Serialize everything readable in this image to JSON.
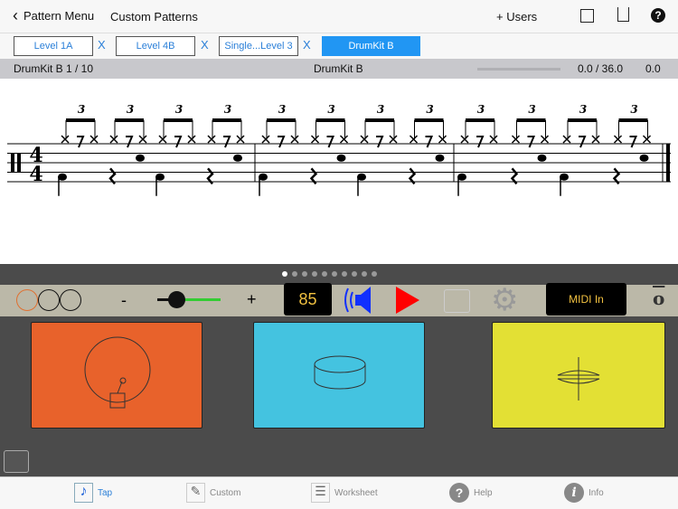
{
  "header": {
    "back_label": "Pattern Menu",
    "title": "Custom Patterns",
    "users_label": "+ Users"
  },
  "tabs": [
    {
      "label": "Level 1A",
      "close": "X"
    },
    {
      "label": "Level 4B",
      "close": "X"
    },
    {
      "label": "Single...Level 3",
      "close": "X"
    },
    {
      "label": "DrumKit B"
    }
  ],
  "info": {
    "left": "DrumKit B 1 / 10",
    "center": "DrumKit B",
    "time": "0.0 / 36.0",
    "value": "0.0",
    "progress": 0
  },
  "score": {
    "time_signature": [
      "4",
      "4"
    ],
    "tuplet": "3",
    "measures": 3
  },
  "pager": {
    "count": 10,
    "active": 0
  },
  "toolbar": {
    "minus": "-",
    "plus": "+",
    "tempo": "85",
    "midi_label": "MIDI In",
    "volume": 0.15
  },
  "colors": {
    "pad_kick": "#e8622b",
    "pad_snare": "#44c3e0",
    "pad_hihat": "#e3e034",
    "accent": "#2196f3"
  },
  "bottom_tabs": [
    {
      "label": "Tap"
    },
    {
      "label": "Custom"
    },
    {
      "label": "Worksheet"
    },
    {
      "label": "Help"
    },
    {
      "label": "Info"
    }
  ]
}
